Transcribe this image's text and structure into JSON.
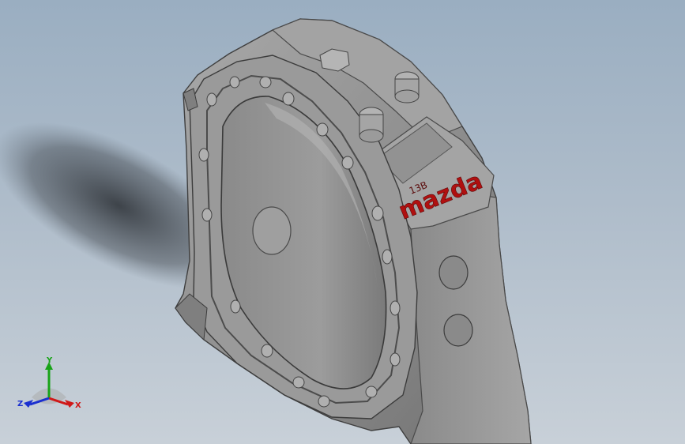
{
  "model": {
    "brand_text": "mazda",
    "displacement_label": "13B"
  },
  "triad": {
    "x_label": "X",
    "y_label": "Y",
    "z_label": "Z",
    "x_color": "#d01818",
    "y_color": "#17a317",
    "z_color": "#1a2fd0"
  },
  "colors": {
    "background_top": "#9aaec1",
    "background_bottom": "#c8d0d8",
    "part_body": "#8f8f8f",
    "part_light": "#b3b3b3",
    "part_dark": "#5e5e5e",
    "brand_red": "#b01010"
  }
}
